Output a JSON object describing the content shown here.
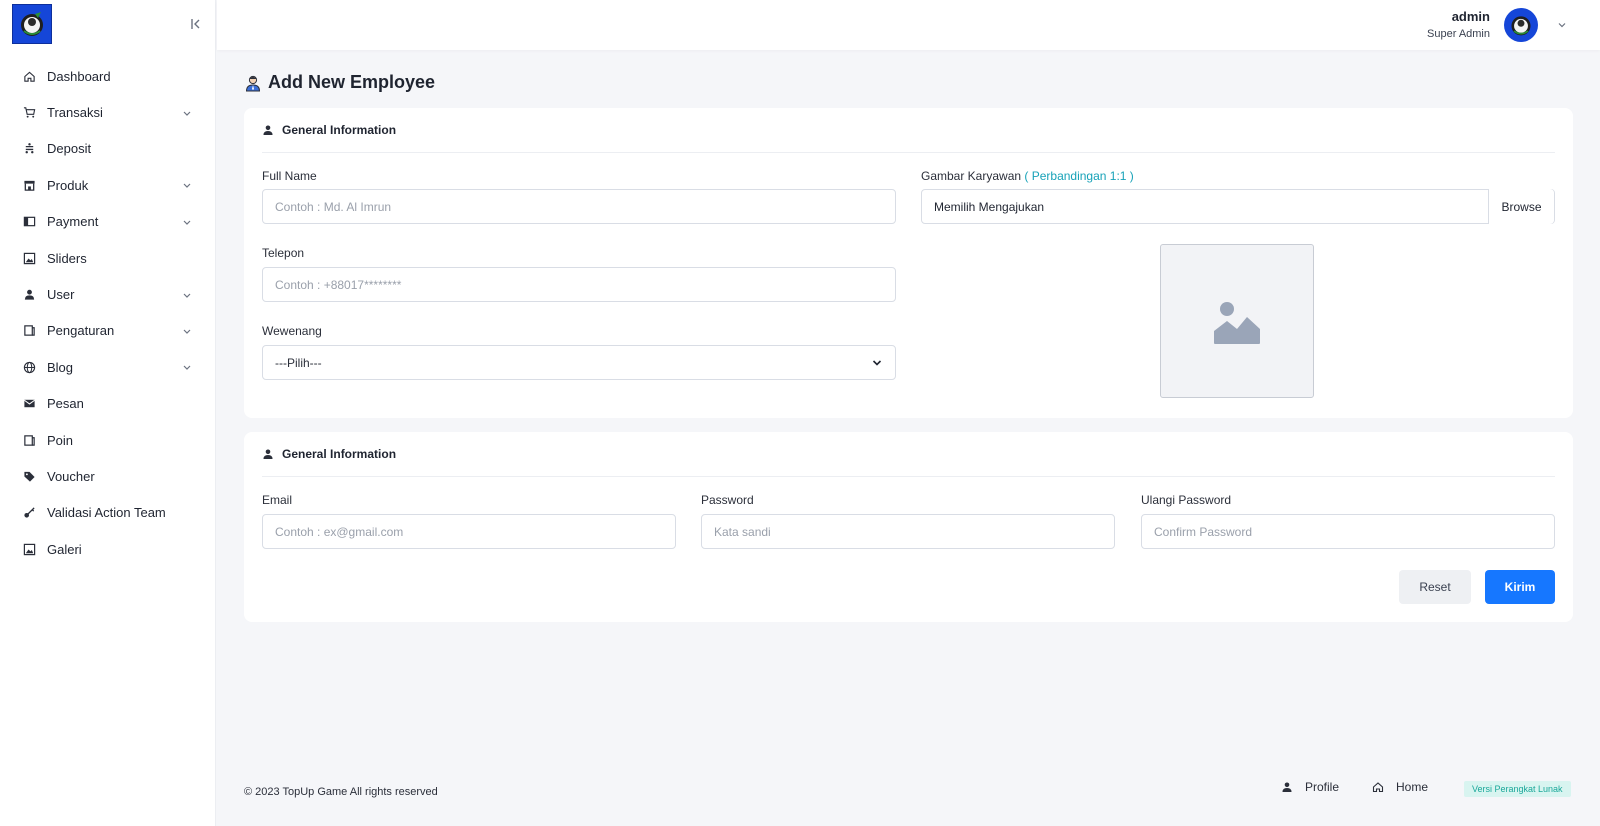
{
  "sidebar": {
    "items": [
      {
        "label": "Dashboard",
        "icon": "home-icon",
        "has_submenu": false
      },
      {
        "label": "Transaksi",
        "icon": "cart-icon",
        "has_submenu": true
      },
      {
        "label": "Deposit",
        "icon": "deposit-icon",
        "has_submenu": false
      },
      {
        "label": "Produk",
        "icon": "store-icon",
        "has_submenu": true
      },
      {
        "label": "Payment",
        "icon": "payment-icon",
        "has_submenu": true
      },
      {
        "label": "Sliders",
        "icon": "image-icon",
        "has_submenu": false
      },
      {
        "label": "User",
        "icon": "user-icon",
        "has_submenu": true
      },
      {
        "label": "Pengaturan",
        "icon": "settings-icon",
        "has_submenu": true
      },
      {
        "label": "Blog",
        "icon": "globe-icon",
        "has_submenu": true
      },
      {
        "label": "Pesan",
        "icon": "mail-icon",
        "has_submenu": false
      },
      {
        "label": "Poin",
        "icon": "points-icon",
        "has_submenu": false
      },
      {
        "label": "Voucher",
        "icon": "tag-icon",
        "has_submenu": false
      },
      {
        "label": "Validasi Action Team",
        "icon": "key-icon",
        "has_submenu": false
      },
      {
        "label": "Galeri",
        "icon": "gallery-icon",
        "has_submenu": false
      }
    ]
  },
  "header": {
    "user_name": "admin",
    "user_role": "Super Admin"
  },
  "page": {
    "title": "Add New Employee"
  },
  "general_info": {
    "heading": "General Information",
    "full_name_label": "Full Name",
    "full_name_placeholder": "Contoh : Md. Al Imrun",
    "phone_label": "Telepon",
    "phone_placeholder": "Contoh : +88017********",
    "role_label": "Wewenang",
    "role_selected": "---Pilih---",
    "image_label": "Gambar Karyawan",
    "image_hint": "( Perbandingan 1:1 )",
    "file_value": "Memilih Mengajukan",
    "browse_label": "Browse"
  },
  "account_info": {
    "heading": "General Information",
    "email_label": "Email",
    "email_placeholder": "Contoh : ex@gmail.com",
    "password_label": "Password",
    "password_placeholder": "Kata sandi",
    "confirm_label": "Ulangi Password",
    "confirm_placeholder": "Confirm Password",
    "reset_label": "Reset",
    "submit_label": "Kirim"
  },
  "footer": {
    "copyright": "© 2023 TopUp Game All rights reserved",
    "profile_label": "Profile",
    "home_label": "Home",
    "version_label": "Versi Perangkat Lunak"
  },
  "colors": {
    "primary": "#1677ff",
    "logo_bg": "#1546d8",
    "hint": "#17a2b8",
    "version_text": "#1ba89a"
  }
}
